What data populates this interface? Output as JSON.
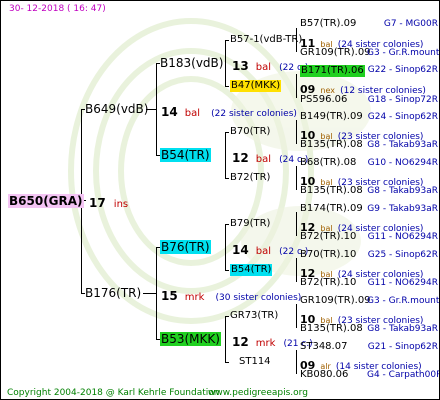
{
  "header": {
    "date": "30-  12-2018  ( 16:  47)"
  },
  "footer": {
    "copyright": "Copyright 2004-2018 @ Karl Kehrle Foundation",
    "website": "www.pedigreeapis.org"
  },
  "root": {
    "name": "B650(GRA)",
    "num": "17",
    "label": "ins"
  },
  "gen1": {
    "a": {
      "name": "B649(vdB)",
      "num": "14",
      "label": "bal",
      "note": "(22 sister colonies)"
    },
    "b": {
      "name": "B176(TR)",
      "num": "15",
      "label": "mrk",
      "note": "(30 sister colonies)"
    }
  },
  "gen2": {
    "a": {
      "name": "B183(vdB)",
      "num": "13",
      "label": "bal",
      "note": "(22 c.)"
    },
    "b": {
      "name": "B54(TR)",
      "num": "12",
      "label": "bal",
      "note": "(24 c.)"
    },
    "c": {
      "name": "B76(TR)",
      "num": "14",
      "label": "bal",
      "note": "(22 c.)"
    },
    "d": {
      "name": "B53(MKK)",
      "num": "12",
      "label": "mrk",
      "note": "(21 c.)"
    }
  },
  "gen3": {
    "a": {
      "name": "B57-1(vdB-TR)"
    },
    "b": {
      "name": "B47(MKK)"
    },
    "c": {
      "name": "B70(TR)"
    },
    "d": {
      "name": "B72(TR)"
    },
    "e": {
      "name": "B79(TR)"
    },
    "f": {
      "name": "B54(TR)"
    },
    "g": {
      "name": "GR73(TR)"
    },
    "h": {
      "name": "ST114"
    }
  },
  "gen3_info": {
    "a": {
      "num": "11",
      "label": "bal",
      "note": "(24 sister colonies)"
    },
    "b": {
      "num": "09",
      "label": "nex",
      "note": "(12 sister colonies)"
    },
    "c": {
      "num": "10",
      "label": "bal",
      "note": "(23 sister colonies)"
    },
    "d": {
      "num": "10",
      "label": "bal",
      "note": "(23 sister colonies)"
    },
    "e": {
      "num": "12",
      "label": "bal",
      "note": "(24 sister colonies)"
    },
    "f": {
      "num": "12",
      "label": "bal",
      "note": "(24 sister colonies)"
    },
    "g": {
      "num": "10",
      "label": "bal",
      "note": "(23 sister colonies)"
    },
    "h": {
      "num": "09",
      "label": "alr",
      "note": "(14 sister colonies)"
    }
  },
  "gen4": [
    {
      "name": "B57(TR).09",
      "source": "G7 - MG00R"
    },
    {
      "name": "GR109(TR).09",
      "source": "G3 - Gr.R.mounta"
    },
    {
      "name": "B171(TR).06",
      "source": "G22 - Sinop62R"
    },
    {
      "name": "PS596.06",
      "source": "G18 - Sinop72R"
    },
    {
      "name": "B149(TR).09",
      "source": "G24 - Sinop62R"
    },
    {
      "name": "B135(TR).08",
      "source": "G8 - Takab93aR"
    },
    {
      "name": "B68(TR).08",
      "source": "G10 - NO6294R"
    },
    {
      "name": "B135(TR).08",
      "source": "G8 - Takab93aR"
    },
    {
      "name": "B174(TR).09",
      "source": "G9 - Takab93aR"
    },
    {
      "name": "B72(TR).10",
      "source": "G11 - NO6294R"
    },
    {
      "name": "B70(TR).10",
      "source": "G25 - Sinop62R"
    },
    {
      "name": "B72(TR).10",
      "source": "G11 - NO6294R"
    },
    {
      "name": "GR109(TR).09",
      "source": "G3 - Gr.R.mounta"
    },
    {
      "name": "B135(TR).08",
      "source": "G8 - Takab93aR"
    },
    {
      "name": "ST348.07",
      "source": "G21 - Sinop62R"
    },
    {
      "name": "KB080.06",
      "source": "G4 - Carpath00R"
    }
  ],
  "colors": {
    "cyan": "#00e0f0",
    "yellow": "#ffe000",
    "green": "#20d020",
    "pink": "#f4c4f4",
    "red": "#c00000",
    "blue": "#0000a8",
    "footer": "#008000"
  }
}
